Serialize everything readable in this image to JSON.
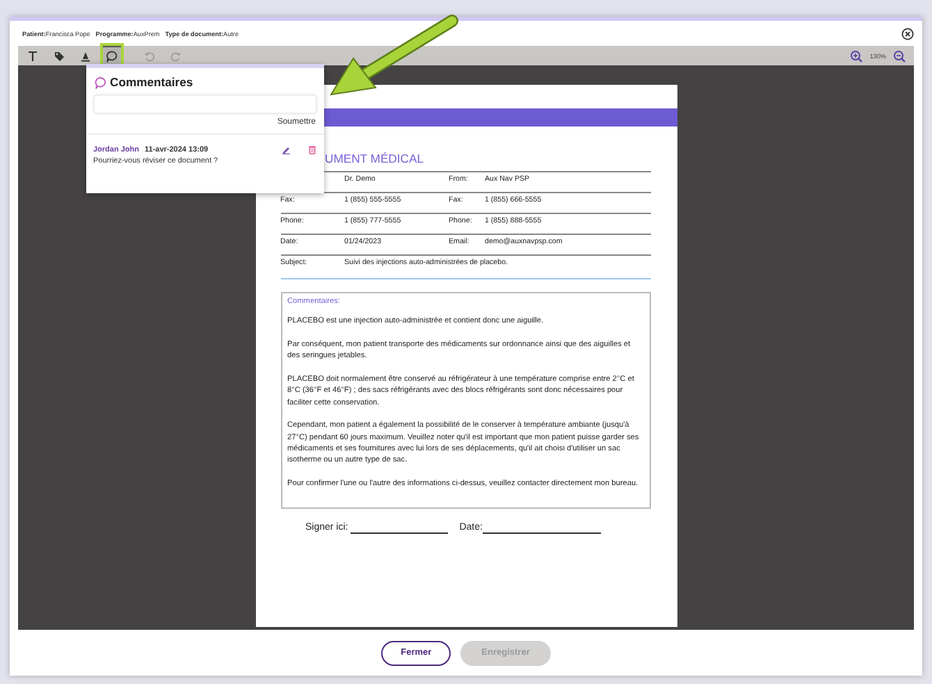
{
  "header": {
    "fields": [
      {
        "label": "Patient:",
        "value": "Francisca Pope"
      },
      {
        "label": "Programme:",
        "value": "AuxPrem"
      },
      {
        "label": "Type de document:",
        "value": "Autre"
      }
    ]
  },
  "toolbar": {
    "tools": [
      {
        "kind": "text",
        "selected": false,
        "disabled": false
      },
      {
        "kind": "stamp",
        "selected": false,
        "disabled": false
      },
      {
        "kind": "highlight",
        "selected": false,
        "disabled": false
      },
      {
        "kind": "comment",
        "selected": true,
        "disabled": false
      },
      {
        "kind": "undo",
        "selected": false,
        "disabled": true
      },
      {
        "kind": "redo",
        "selected": false,
        "disabled": true
      }
    ],
    "zoom": "130%"
  },
  "comments_panel": {
    "title": "Commentaires",
    "submit": "Soumettre",
    "comments": [
      {
        "author": "Jordan John",
        "date": "11-avr-2024 13:09",
        "text": "Pourriez-vous réviser ce document ?"
      }
    ]
  },
  "document": {
    "heading": "UMENT MÉDICAL",
    "rows": [
      {
        "value": "Dr. Demo",
        "label2": "From:",
        "value2": "Aux Nav PSP"
      },
      {
        "label": "Fax:",
        "value": "1 (855) 555-5555",
        "label2": "Fax:",
        "value2": "1 (855) 666-5555"
      },
      {
        "label": "Phone:",
        "value": "1 (855) 777-5555",
        "label2": "Phone:",
        "value2": "1 (855) 888-5555"
      },
      {
        "label": "Date:",
        "value": "01/24/2023",
        "label2": "Email:",
        "value2": "demo@auxnavpsp.com"
      }
    ],
    "subject": {
      "label": "Subject:",
      "value": "Suivi des injections auto-administrées de placebo."
    },
    "comments_box": {
      "title": "Commentaires:",
      "paragraphs": [
        "PLACEBO est une injection auto-administrée et contient donc une aiguille.",
        "Par conséquent, mon patient transporte des médicaments sur ordonnance ainsi que des aiguilles et des seringues jetables.",
        "PLACEBO doit normalement être conservé au réfrigérateur à une température comprise entre 2°C et 8°C (36°F et 46°F) ; des sacs réfrigérants avec des blocs réfrigérants sont donc nécessaires pour faciliter cette conservation.",
        "Cependant, mon patient a également la possibilité de le conserver à température ambiante (jusqu'à 27°C) pendant 60 jours maximum. Veuillez noter qu'il est important que mon patient puisse garder ses médicaments et ses fournitures avec lui lors de ses déplacements, qu'il ait choisi d'utiliser un sac isotherme ou un autre type de sac.",
        "Pour confirmer l'une ou l'autre des informations ci-dessus, veuillez contacter directement mon bureau."
      ]
    },
    "signature": {
      "sign_label": "Signer ici:",
      "date_label": "Date:"
    }
  },
  "buttons": [
    {
      "label": "Fermer",
      "kind": "secondary",
      "disabled": false
    },
    {
      "label": "Enregistrer",
      "kind": "primary",
      "disabled": true
    }
  ]
}
